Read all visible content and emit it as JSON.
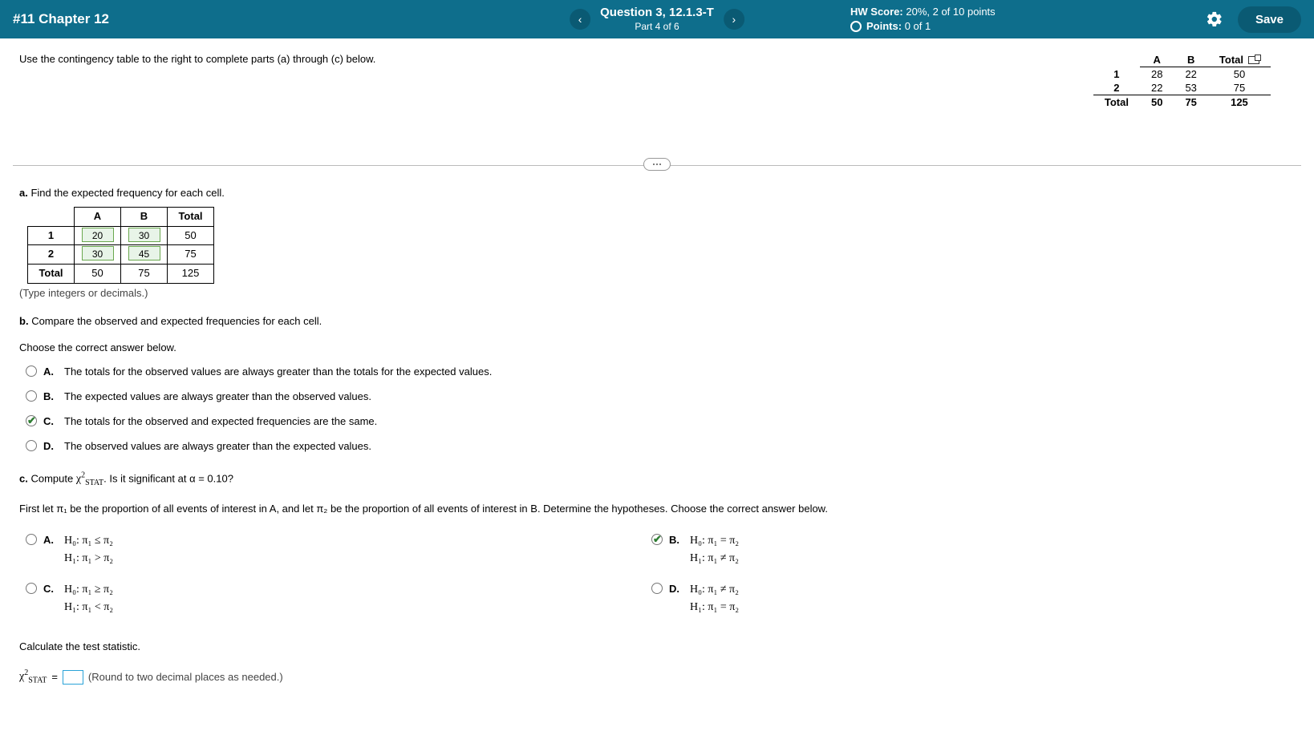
{
  "header": {
    "hw_title": "#11 Chapter 12",
    "question_title": "Question 3, 12.1.3-T",
    "question_sub": "Part 4 of 6",
    "hw_score_label": "HW Score:",
    "hw_score_value": "20%, 2 of 10 points",
    "points_label": "Points:",
    "points_value": "0 of 1",
    "save": "Save"
  },
  "prompt": "Use the contingency table to the right to complete parts (a) through (c) below.",
  "ct": {
    "col_a": "A",
    "col_b": "B",
    "col_total": "Total",
    "row1": "1",
    "r1a": "28",
    "r1b": "22",
    "r1t": "50",
    "row2": "2",
    "r2a": "22",
    "r2b": "53",
    "r2t": "75",
    "row_total": "Total",
    "rta": "50",
    "rtb": "75",
    "rtt": "125"
  },
  "a": {
    "label": "a.",
    "text": "Find the expected frequency for each cell.",
    "col_a": "A",
    "col_b": "B",
    "col_total": "Total",
    "row1": "1",
    "r1a": "20",
    "r1b": "30",
    "r1t": "50",
    "row2": "2",
    "r2a": "30",
    "r2b": "45",
    "r2t": "75",
    "row_total": "Total",
    "rta": "50",
    "rtb": "75",
    "rtt": "125",
    "hint": "(Type integers or decimals.)"
  },
  "b": {
    "label": "b.",
    "text": "Compare the observed and expected frequencies for each cell.",
    "choose": "Choose the correct answer below.",
    "A": "The totals for the observed values are always greater than the totals for the expected values.",
    "B": "The expected values are always greater than the observed values.",
    "C": "The totals for the observed and expected frequencies are the same.",
    "D": "The observed values are always greater than the expected values."
  },
  "c": {
    "label": "c.",
    "text_pre": "Compute ",
    "text_post": ". Is it significant at α = 0.10?",
    "first_let": "First let π₁ be the proportion of all events of interest in A, and let π₂ be the proportion of all events of interest in B. Determine the hypotheses. Choose the correct answer below.",
    "A_h0": "H₀: π₁ ≤ π₂",
    "A_h1": "H₁: π₁ > π₂",
    "B_h0": "H₀: π₁ = π₂",
    "B_h1": "H₁: π₁ ≠ π₂",
    "C_h0": "H₀: π₁ ≥ π₂",
    "C_h1": "H₁: π₁ < π₂",
    "D_h0": "H₀: π₁ ≠ π₂",
    "D_h1": "H₁: π₁ = π₂",
    "calc": "Calculate the test statistic.",
    "eq": " = ",
    "round": "(Round to two decimal places as needed.)"
  },
  "letters": {
    "A": "A.",
    "B": "B.",
    "C": "C.",
    "D": "D."
  }
}
